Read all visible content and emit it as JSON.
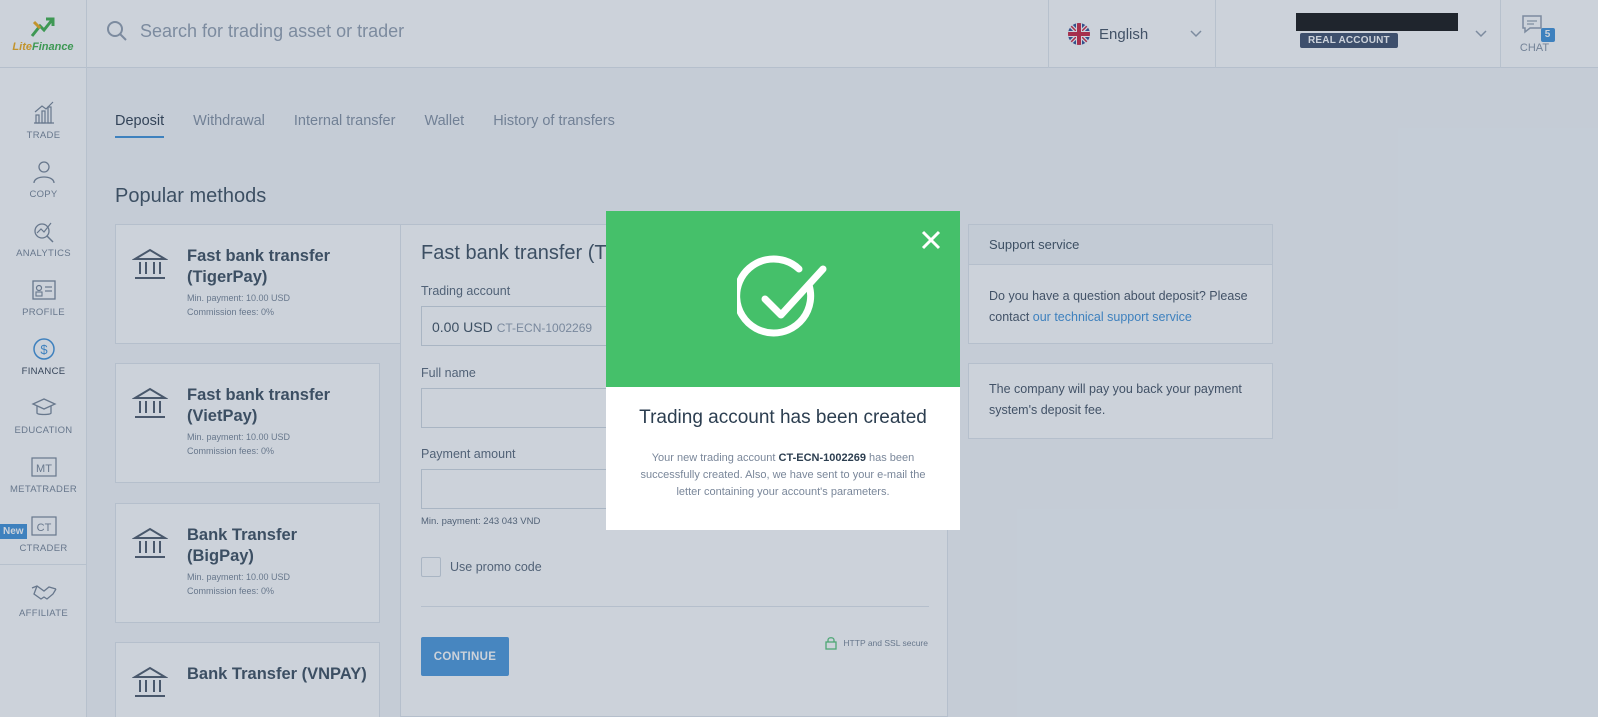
{
  "header": {
    "logo_text_lite": "Lite",
    "logo_text_finance": "Finance",
    "search_placeholder": "Search for trading asset or trader",
    "language": "English",
    "account_badge": "REAL ACCOUNT",
    "chat_label": "CHAT",
    "chat_count": "5"
  },
  "sidebar": {
    "items": [
      {
        "label": "TRADE",
        "icon": "chart-icon"
      },
      {
        "label": "COPY",
        "icon": "user-icon"
      },
      {
        "label": "ANALYTICS",
        "icon": "analytics-icon"
      },
      {
        "label": "PROFILE",
        "icon": "id-card-icon"
      },
      {
        "label": "FINANCE",
        "icon": "dollar-icon"
      },
      {
        "label": "EDUCATION",
        "icon": "graduation-cap-icon"
      },
      {
        "label": "METATRADER",
        "icon": "mt-icon"
      },
      {
        "label": "CTRADER",
        "icon": "ct-icon"
      },
      {
        "label": "AFFILIATE",
        "icon": "handshake-icon"
      }
    ],
    "new_badge": "New",
    "mt_text": "MT",
    "ct_text": "CT"
  },
  "tabs": [
    "Deposit",
    "Withdrawal",
    "Internal transfer",
    "Wallet",
    "History of transfers"
  ],
  "section_title": "Popular methods",
  "methods": [
    {
      "name": "Fast bank transfer (TigerPay)",
      "min": "Min. payment: 10.00 USD",
      "fee": "Commission fees: 0%"
    },
    {
      "name": "Fast bank transfer (VietPay)",
      "min": "Min. payment: 10.00 USD",
      "fee": "Commission fees: 0%"
    },
    {
      "name": "Bank Transfer (BigPay)",
      "min": "Min. payment: 10.00 USD",
      "fee": "Commission fees: 0%"
    },
    {
      "name": "Bank Transfer (VNPAY)",
      "min": "",
      "fee": ""
    }
  ],
  "form": {
    "title": "Fast bank transfer (TigerPay)",
    "trading_account_label": "Trading account",
    "account_value": "0.00 USD",
    "account_id": "CT-ECN-1002269",
    "full_name_label": "Full name",
    "payment_amount_label": "Payment amount",
    "min_payment": "Min. payment: 243 043 VND",
    "promo_label": "Use promo code",
    "continue": "CONTINUE",
    "secure": "HTTP and SSL secure"
  },
  "support": {
    "title": "Support service",
    "text": "Do you have a question about deposit? Please contact ",
    "link": "our technical support service"
  },
  "fee_note": "The company will pay you back your payment system's deposit fee.",
  "modal": {
    "title": "Trading account has been created",
    "text_pre": "Your new trading account ",
    "account": "CT-ECN-1002269",
    "text_post": " has been successfully created. Also, we have sent to your e-mail the letter containing your account's parameters."
  },
  "colors": {
    "accent": "#2f88d6",
    "success": "#45c06a",
    "badge": "#2d3f5e"
  }
}
